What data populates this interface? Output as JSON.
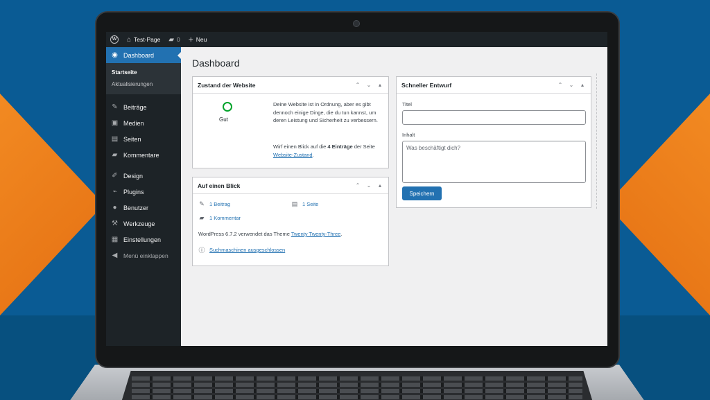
{
  "adminbar": {
    "wp_logo": "W",
    "site_name": "Test-Page",
    "comments_count": "0",
    "new_label": "Neu"
  },
  "sidebar": {
    "active_label": "Dashboard",
    "submenu": [
      "Startseite",
      "Aktualisierungen"
    ],
    "items": [
      {
        "label": "Beiträge",
        "icon": "pin-icon"
      },
      {
        "label": "Medien",
        "icon": "media-icon"
      },
      {
        "label": "Seiten",
        "icon": "pages-icon"
      },
      {
        "label": "Kommentare",
        "icon": "comment-icon"
      },
      {
        "label": "Design",
        "icon": "brush-icon"
      },
      {
        "label": "Plugins",
        "icon": "plugin-icon"
      },
      {
        "label": "Benutzer",
        "icon": "user-icon"
      },
      {
        "label": "Werkzeuge",
        "icon": "wrench-icon"
      },
      {
        "label": "Einstellungen",
        "icon": "settings-icon"
      }
    ],
    "collapse_label": "Menü einklappen"
  },
  "main": {
    "page_title": "Dashboard",
    "site_health": {
      "title": "Zustand der Website",
      "status": "Gut",
      "text1": "Deine Website ist in Ordnung, aber es gibt dennoch einige Dinge, die du tun kannst, um deren Leistung und Sicherheit zu verbessern.",
      "text2_prefix": "Wirf einen Blick auf die ",
      "text2_bold": "4 Einträge",
      "text2_middle": " der Seite ",
      "text2_link": "Website-Zustand",
      "text2_suffix": "."
    },
    "at_a_glance": {
      "title": "Auf einen Blick",
      "posts": "1 Beitrag",
      "pages": "1 Seite",
      "comments": "1 Kommentar",
      "theme_prefix": "WordPress 6.7.2 verwendet das Theme ",
      "theme_link": "Twenty Twenty-Three",
      "theme_suffix": ".",
      "search_engines": "Suchmaschinen ausgeschlossen"
    },
    "quick_draft": {
      "title": "Schneller Entwurf",
      "title_label": "Titel",
      "title_value": "",
      "content_label": "Inhalt",
      "content_placeholder": "Was beschäftigt dich?",
      "save_label": "Speichern"
    },
    "box_controls": {
      "up": "⌃",
      "down": "⌄",
      "toggle": "▴"
    }
  },
  "colors": {
    "admin_dark": "#1d2327",
    "accent_blue": "#2271b1",
    "health_green": "#00a32a",
    "background_blue": "#0a5b94",
    "background_orange": "#f07b1c"
  }
}
